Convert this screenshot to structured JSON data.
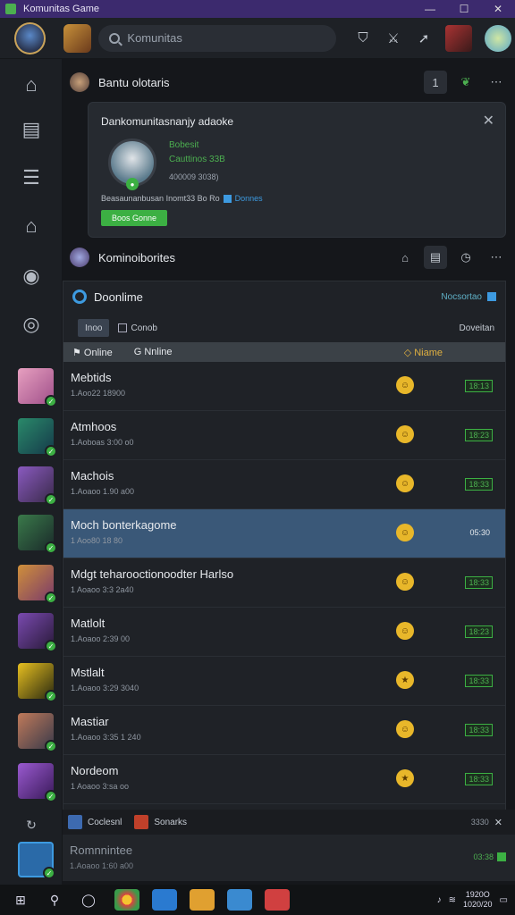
{
  "window": {
    "title": "Komunitas Game",
    "minimize": "—",
    "maximize": "☐",
    "close": "✕"
  },
  "topbar": {
    "search_placeholder": "Komunitas"
  },
  "feed_header": {
    "title": "Bantu olotaris",
    "count_btn": "1"
  },
  "promo": {
    "title": "Dankomunitasnanjy adaoke",
    "line1": "Bobesit",
    "line2": "Cauttinos 33B",
    "line3": "400009 3038)",
    "info_text": "Beasaunanbusan Inomt33 Bo Ro",
    "info_link": "Donnes",
    "button": "Boos Gonne"
  },
  "community_header": {
    "title": "Kominoiborites"
  },
  "panel": {
    "title": "Doonlime",
    "right_label": "Nocsortao",
    "filter_tab": "Inoo",
    "filter_sort": "Conob",
    "filter_right": "Doveitan",
    "col_online_1": "Online",
    "col_online_2": "Nnline",
    "col_name": "Niame"
  },
  "rows": [
    {
      "name": "Mebtids",
      "sub": "1.Aoo22 18900",
      "time": "18:13",
      "emoji": "☺",
      "selected": false
    },
    {
      "name": "Atmhoos",
      "sub": "1.Aoboas 3:00 o0",
      "time": "18:23",
      "emoji": "☺",
      "selected": false
    },
    {
      "name": "Machois",
      "sub": "1.Aoaoo 1.90 a00",
      "time": "18:33",
      "emoji": "☺",
      "selected": false
    },
    {
      "name": "Moch bonterkagome",
      "sub": "1 Aoo80 18 80",
      "time": "05:30",
      "emoji": "☺",
      "selected": true
    },
    {
      "name": "Mdgt teharooctionoodter Harlso",
      "sub": "1 Aoaoo 3:3 2a40",
      "time": "18:33",
      "emoji": "☺",
      "selected": false
    },
    {
      "name": "Matlolt",
      "sub": "1.Aoaoo 2:39 00",
      "time": "18:23",
      "emoji": "☺",
      "selected": false
    },
    {
      "name": "Mstlalt",
      "sub": "1.Aoaoo 3:29 3040",
      "time": "18:33",
      "emoji": "★",
      "selected": false
    },
    {
      "name": "Mastiar",
      "sub": "1.Aoaoo 3:35 1 240",
      "time": "18:33",
      "emoji": "☺",
      "selected": false
    },
    {
      "name": "Nordeom",
      "sub": "1 Aoaoo 3:sa oo",
      "time": "18:33",
      "emoji": "★",
      "selected": false
    }
  ],
  "subbar": {
    "item1": "Coclesnl",
    "item2": "Sonarks",
    "right": "3330"
  },
  "lastrow": {
    "name": "Romnnintee",
    "sub": "1.Aoaoo 1:60 a00",
    "time": "03:38"
  },
  "taskbar": {
    "time": "1920O",
    "date": "1020/20"
  },
  "colors": {
    "accent": "#3cb043",
    "selected_row": "#3a5878",
    "titlebar": "#3c2a6e"
  }
}
